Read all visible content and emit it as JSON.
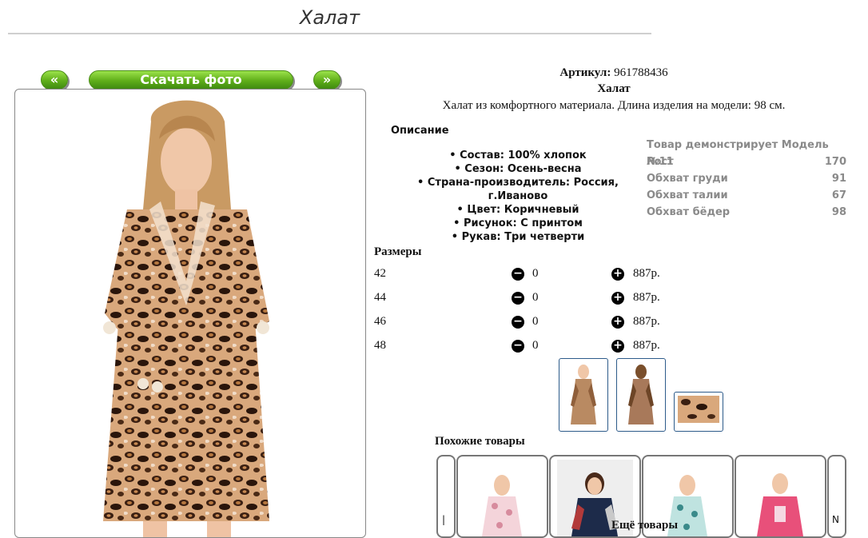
{
  "page": {
    "title": "Халат"
  },
  "gallery": {
    "prev_label": "«",
    "download_label": "Скачать фото",
    "next_label": "»"
  },
  "product": {
    "article_label": "Артикул:",
    "article_value": "961788436",
    "name": "Халат",
    "description": "Халат из комфортного материала. Длина изделия на модели: 98 см."
  },
  "specs": {
    "heading": "Описание",
    "items": [
      "Состав: 100% хлопок",
      "Сезон: Осень-весна",
      "Страна-производитель: Россия, г.Иваново",
      "Цвет: Коричневый",
      "Рисунок: С принтом",
      "Рукав: Три четверти"
    ]
  },
  "model": {
    "heading": "Товар демонстрирует Модель №11",
    "rows": [
      {
        "label": "Рост",
        "value": "170"
      },
      {
        "label": "Обхват груди",
        "value": "91"
      },
      {
        "label": "Обхват талии",
        "value": "67"
      },
      {
        "label": "Обхват бёдер",
        "value": "98"
      }
    ]
  },
  "sizes": {
    "heading": "Размеры",
    "minus_icon": "minus-circle-icon",
    "plus_icon": "plus-circle-icon",
    "rows": [
      {
        "size": "42",
        "qty": "0",
        "price": "887р."
      },
      {
        "size": "44",
        "qty": "0",
        "price": "887р."
      },
      {
        "size": "46",
        "qty": "0",
        "price": "887р."
      },
      {
        "size": "48",
        "qty": "0",
        "price": "887р."
      }
    ]
  },
  "similar": {
    "heading": "Похожие товары",
    "prev_arrow": "|",
    "next_arrow": "N",
    "more_label": "Ещё товары"
  },
  "colors": {
    "accent_green": "#5fae1a",
    "thumb_border": "#2d5b8a",
    "muted_text": "#8a8a8a"
  }
}
